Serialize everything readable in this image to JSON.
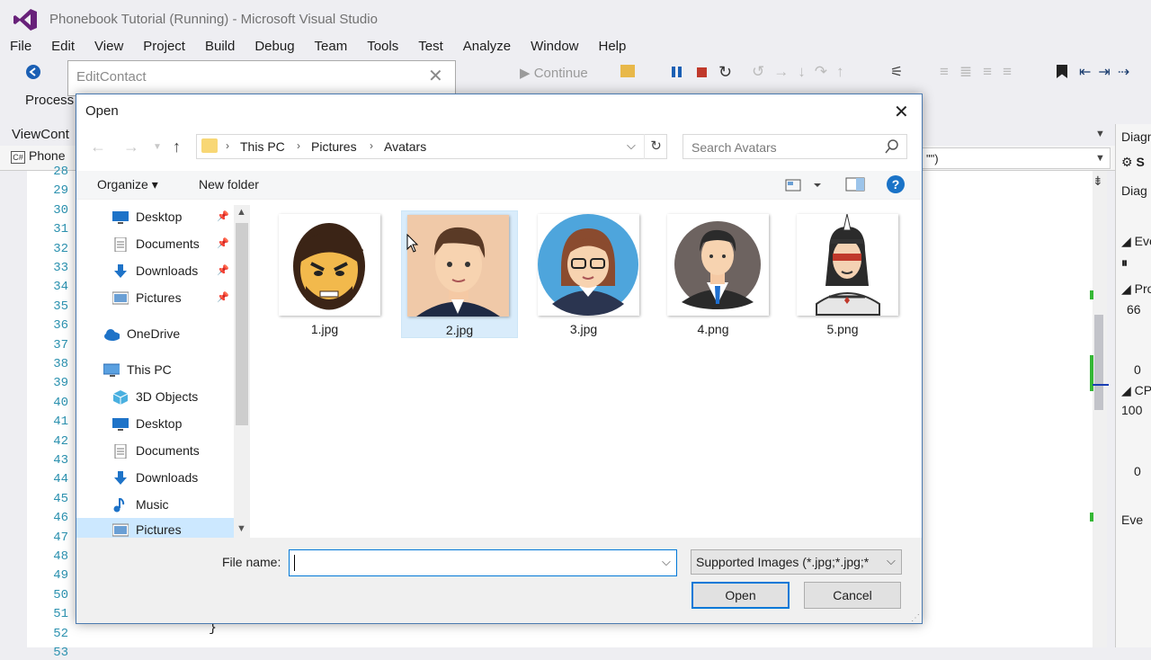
{
  "window": {
    "title": "Phonebook Tutorial (Running) - Microsoft Visual Studio"
  },
  "menu": [
    "File",
    "Edit",
    "View",
    "Project",
    "Build",
    "Debug",
    "Team",
    "Tools",
    "Test",
    "Analyze",
    "Window",
    "Help"
  ],
  "toolbar": {
    "continue_label": "Continue",
    "process_label": "Process"
  },
  "editor": {
    "view_label": "ViewCont",
    "tab_label": "Phone",
    "cs_badge": "C#",
    "line_numbers": [
      "28",
      "29",
      "30",
      "31",
      "32",
      "33",
      "34",
      "35",
      "36",
      "37",
      "38",
      "39",
      "40",
      "41",
      "42",
      "43",
      "44",
      "45",
      "46",
      "47",
      "48",
      "49",
      "50",
      "51",
      "52",
      "53"
    ],
    "brace": "}",
    "right_combo": "\"\")"
  },
  "diagnostics": {
    "title": "Diagn",
    "settings_suffix": "S",
    "diag": "Diag",
    "events": "Eve",
    "process": "Pro",
    "process_val": "66",
    "zero1": "0",
    "cpu": "CP",
    "cpu_val": "100",
    "zero2": "0",
    "events2": "Eve"
  },
  "edit_contact": {
    "title": "EditContact",
    "close": "✕"
  },
  "dialog": {
    "title": "Open",
    "close": "✕",
    "breadcrumbs": [
      "This PC",
      "Pictures",
      "Avatars"
    ],
    "search_placeholder": "Search Avatars",
    "organize_label": "Organize ▾",
    "new_folder_label": "New folder",
    "help": "?",
    "nav_items": [
      {
        "label": "Desktop",
        "icon": "desktop-icon",
        "pinned": true
      },
      {
        "label": "Documents",
        "icon": "documents-icon",
        "pinned": true
      },
      {
        "label": "Downloads",
        "icon": "downloads-icon",
        "pinned": true
      },
      {
        "label": "Pictures",
        "icon": "pictures-icon",
        "pinned": true
      },
      {
        "label": "OneDrive",
        "icon": "onedrive-icon"
      },
      {
        "label": "This PC",
        "icon": "this-pc-icon"
      },
      {
        "label": "3D Objects",
        "icon": "3d-objects-icon"
      },
      {
        "label": "Desktop",
        "icon": "desktop-icon"
      },
      {
        "label": "Documents",
        "icon": "documents-icon"
      },
      {
        "label": "Downloads",
        "icon": "downloads-icon"
      },
      {
        "label": "Music",
        "icon": "music-icon"
      },
      {
        "label": "Pictures",
        "icon": "pictures-icon",
        "selected": true
      }
    ],
    "files": [
      {
        "name": "1.jpg",
        "icon": "angry-bearded-man-avatar"
      },
      {
        "name": "2.jpg",
        "icon": "businessman-avatar",
        "selected": true
      },
      {
        "name": "3.jpg",
        "icon": "woman-glasses-avatar"
      },
      {
        "name": "4.png",
        "icon": "man-in-suit-avatar"
      },
      {
        "name": "5.png",
        "icon": "native-american-avatar"
      }
    ],
    "file_name_label": "File name:",
    "file_name_value": "",
    "filter_value": "Supported Images (*.jpg;*.jpg;*",
    "open_label": "Open",
    "cancel_label": "Cancel"
  },
  "colors": {
    "accent": "#0078d7",
    "selection": "#cce8ff",
    "vs_pause": "#1a5fb4",
    "vs_stop": "#c0392b"
  }
}
